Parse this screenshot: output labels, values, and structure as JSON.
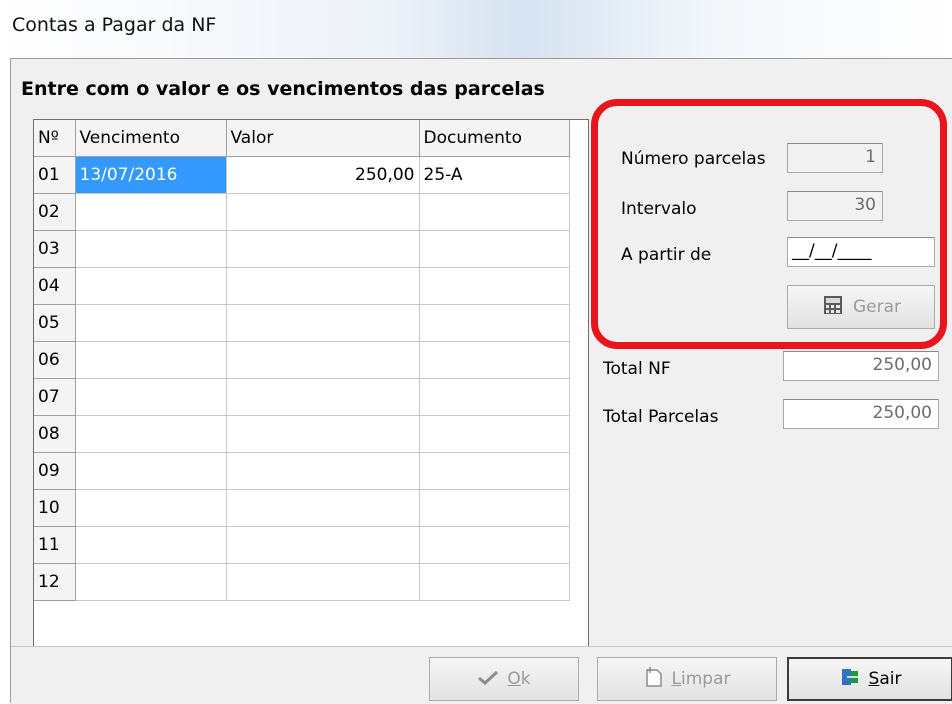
{
  "window": {
    "title": "Contas a Pagar da NF"
  },
  "heading": "Entre com o valor e os vencimentos das parcelas",
  "grid": {
    "columns": [
      "Nº",
      "Vencimento",
      "Valor",
      "Documento"
    ],
    "rows": [
      {
        "n": "01",
        "vencimento": "13/07/2016",
        "valor": "250,00",
        "documento": "25-A"
      },
      {
        "n": "02",
        "vencimento": "",
        "valor": "",
        "documento": ""
      },
      {
        "n": "03",
        "vencimento": "",
        "valor": "",
        "documento": ""
      },
      {
        "n": "04",
        "vencimento": "",
        "valor": "",
        "documento": ""
      },
      {
        "n": "05",
        "vencimento": "",
        "valor": "",
        "documento": ""
      },
      {
        "n": "06",
        "vencimento": "",
        "valor": "",
        "documento": ""
      },
      {
        "n": "07",
        "vencimento": "",
        "valor": "",
        "documento": ""
      },
      {
        "n": "08",
        "vencimento": "",
        "valor": "",
        "documento": ""
      },
      {
        "n": "09",
        "vencimento": "",
        "valor": "",
        "documento": ""
      },
      {
        "n": "10",
        "vencimento": "",
        "valor": "",
        "documento": ""
      },
      {
        "n": "11",
        "vencimento": "",
        "valor": "",
        "documento": ""
      },
      {
        "n": "12",
        "vencimento": "",
        "valor": "",
        "documento": ""
      }
    ]
  },
  "form": {
    "numero_parcelas_label": "Número parcelas",
    "numero_parcelas_value": "1",
    "intervalo_label": "Intervalo",
    "intervalo_value": "30",
    "a_partir_de_label": "A partir de",
    "a_partir_de_value": "__/__/____",
    "gerar_label": "Gerar",
    "total_nf_label": "Total NF",
    "total_nf_value": "250,00",
    "total_parcelas_label": "Total Parcelas",
    "total_parcelas_value": "250,00"
  },
  "buttons": {
    "ok_underlined": "O",
    "ok_rest": "k",
    "limpar_underlined": "L",
    "limpar_rest": "impar",
    "sair_underlined": "S",
    "sair_rest": "air"
  },
  "colors": {
    "highlight_border": "#e8141e",
    "selection": "#3399ff"
  }
}
